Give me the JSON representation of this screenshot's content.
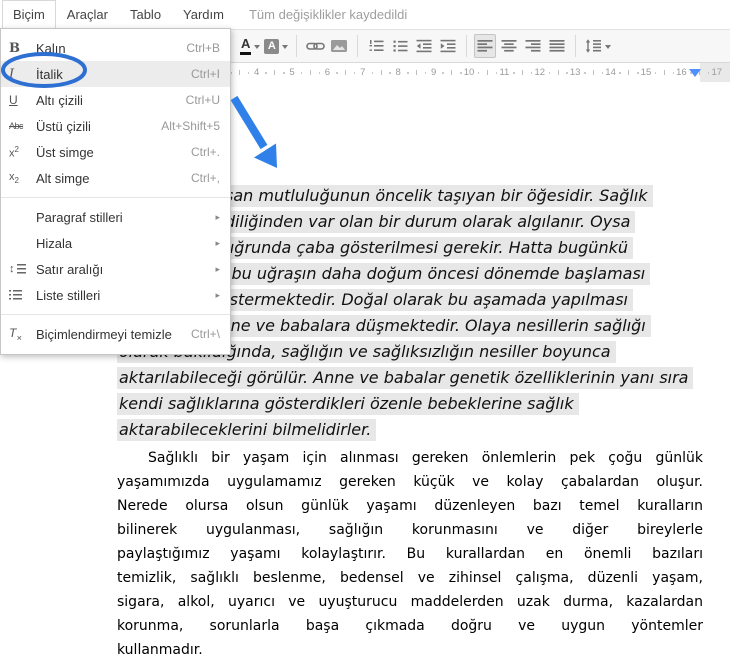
{
  "menubar": {
    "items": [
      {
        "label": "Biçim",
        "active": true
      },
      {
        "label": "Araçlar",
        "active": false
      },
      {
        "label": "Tablo",
        "active": false
      },
      {
        "label": "Yardım",
        "active": false
      }
    ],
    "status": "Tüm değişiklikler kaydedildi"
  },
  "format_menu": {
    "items": [
      {
        "icon": "bold-icon",
        "label": "Kalın",
        "shortcut": "Ctrl+B"
      },
      {
        "icon": "italic-icon",
        "label": "İtalik",
        "shortcut": "Ctrl+I",
        "highlighted": true,
        "circled": true
      },
      {
        "icon": "underline-icon",
        "label": "Altı çizili",
        "shortcut": "Ctrl+U"
      },
      {
        "icon": "strikethrough-icon",
        "label": "Üstü çizili",
        "shortcut": "Alt+Shift+5"
      },
      {
        "icon": "superscript-icon",
        "label": "Üst simge",
        "shortcut": "Ctrl+."
      },
      {
        "icon": "subscript-icon",
        "label": "Alt simge",
        "shortcut": "Ctrl+,"
      },
      {
        "divider": true
      },
      {
        "label": "Paragraf stilleri",
        "submenu": true
      },
      {
        "label": "Hizala",
        "submenu": true
      },
      {
        "icon": "line-spacing-icon",
        "label": "Satır aralığı",
        "submenu": true
      },
      {
        "icon": "list-styles-icon",
        "label": "Liste stilleri",
        "submenu": true
      },
      {
        "divider": true
      },
      {
        "icon": "clear-formatting-icon",
        "label": "Biçimlendirmeyi temizle",
        "shortcut": "Ctrl+\\"
      }
    ]
  },
  "toolbar": {
    "buttons": [
      "text-color",
      "highlight-color",
      "insert-link",
      "insert-image",
      "numbered-list",
      "bulleted-list",
      "decrease-indent",
      "increase-indent",
      "align-left",
      "align-center",
      "align-right",
      "justify",
      "line-spacing"
    ],
    "active_button": "align-left"
  },
  "ruler": {
    "min": 1,
    "max": 17,
    "right_indent_marker_at": 16.4
  },
  "document": {
    "selected_paragraph": {
      "style": "italic",
      "highlight_color": "#e7e7e7",
      "lines": [
        "Sağlık, insan mutluluğunun öncelik taşıyan bir öğesidir. Sağlık",
        "çoğu kez kendiliğinden var olan bir durum olarak algılanır. Oysa",
        "sağlıklı olma uğrunda çaba gösterilmesi gerekir. Hatta bugünkü",
        "tıp bilimi bize bu uğraşın daha doğum öncesi dönemde başlaması",
        "gerektiğini göstermektedir. Doğal olarak bu aşamada yapılması",
        "gerekenler anne ve babalara düşmektedir. Olaya nesillerin sağlığı",
        "olarak bakıldığında, sağlığın ve sağlıksızlığın nesiller boyunca",
        "aktarılabileceği görülür. Anne ve babalar genetik özelliklerinin yanı sıra",
        "kendi sağlıklarına gösterdikleri özenle bebeklerine sağlık",
        "aktarabileceklerini bilmelidirler."
      ]
    },
    "paragraph": {
      "align": "justify",
      "lines": [
        "Sağlıklı bir yaşam için alınması gereken önlemlerin pek çoğu günlük",
        "yaşamımızda uygulamamız gereken küçük ve kolay çabalardan oluşur.",
        "Nerede olursa olsun günlük yaşamı düzenleyen bazı temel kuralların",
        "bilinerek uygulanması, sağlığın korunmasını ve diğer bireylerle",
        "paylaştığımız yaşamı kolaylaştırır. Bu kurallardan en önemli bazıları",
        "temizlik, sağlıklı beslenme, bedensel ve zihinsel çalışma, düzenli yaşam,",
        "sigara, alkol, uyarıcı ve uyuşturucu maddelerden uzak durma, kazalardan",
        "korunma, sorunlarla başa çıkmada doğru ve uygun yöntemler",
        "kullanmadır."
      ]
    }
  },
  "annotations": {
    "ellipse_color": "#2e6fd2",
    "arrow_color": "#2f80e8",
    "marker_color": "#4d90fe"
  }
}
